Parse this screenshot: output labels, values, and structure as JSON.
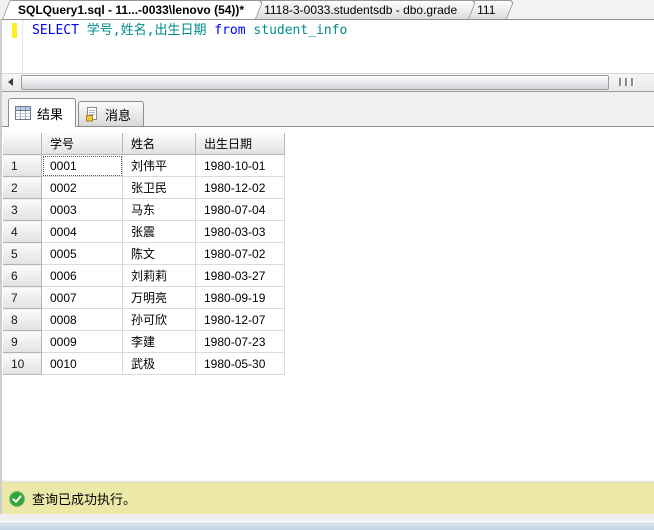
{
  "doc_tabs": [
    {
      "label": "SQLQuery1.sql - 11...-0033\\lenovo (54))*",
      "active": true
    },
    {
      "label": "1118-3-0033.studentsdb - dbo.grade",
      "active": false
    },
    {
      "label": "111",
      "active": false
    }
  ],
  "editor": {
    "segments": [
      {
        "text": "SELECT",
        "type": "keyword"
      },
      {
        "text": " 学号,姓名,出生日期 ",
        "type": "identifier"
      },
      {
        "text": "from",
        "type": "keyword"
      },
      {
        "text": " student_info",
        "type": "identifier"
      }
    ],
    "colors": {
      "keyword": "#0000FF",
      "identifier": "#008B8B",
      "change_bar": "#FFEE21"
    }
  },
  "results_tabs": [
    {
      "label": "结果",
      "icon": "results-grid-icon",
      "active": true
    },
    {
      "label": "消息",
      "icon": "messages-icon",
      "active": false
    }
  ],
  "grid": {
    "columns": [
      "学号",
      "姓名",
      "出生日期"
    ],
    "rows": [
      {
        "num": "1",
        "cells": [
          "0001",
          "刘伟平",
          "1980-10-01"
        ]
      },
      {
        "num": "2",
        "cells": [
          "0002",
          "张卫民",
          "1980-12-02"
        ]
      },
      {
        "num": "3",
        "cells": [
          "0003",
          "马东",
          "1980-07-04"
        ]
      },
      {
        "num": "4",
        "cells": [
          "0004",
          "张震",
          "1980-03-03"
        ]
      },
      {
        "num": "5",
        "cells": [
          "0005",
          "陈文",
          "1980-07-02"
        ]
      },
      {
        "num": "6",
        "cells": [
          "0006",
          "刘莉莉",
          "1980-03-27"
        ]
      },
      {
        "num": "7",
        "cells": [
          "0007",
          "万明亮",
          "1980-09-19"
        ]
      },
      {
        "num": "8",
        "cells": [
          "0008",
          "孙可欣",
          "1980-12-07"
        ]
      },
      {
        "num": "9",
        "cells": [
          "0009",
          "李建",
          "1980-07-23"
        ]
      },
      {
        "num": "10",
        "cells": [
          "0010",
          "武极",
          "1980-05-30"
        ]
      }
    ],
    "focused_cell": {
      "row": 0,
      "col": 0
    }
  },
  "status": {
    "message": "查询已成功执行。",
    "bg": "#ECE9A8",
    "icon_color": "#2FA838"
  }
}
